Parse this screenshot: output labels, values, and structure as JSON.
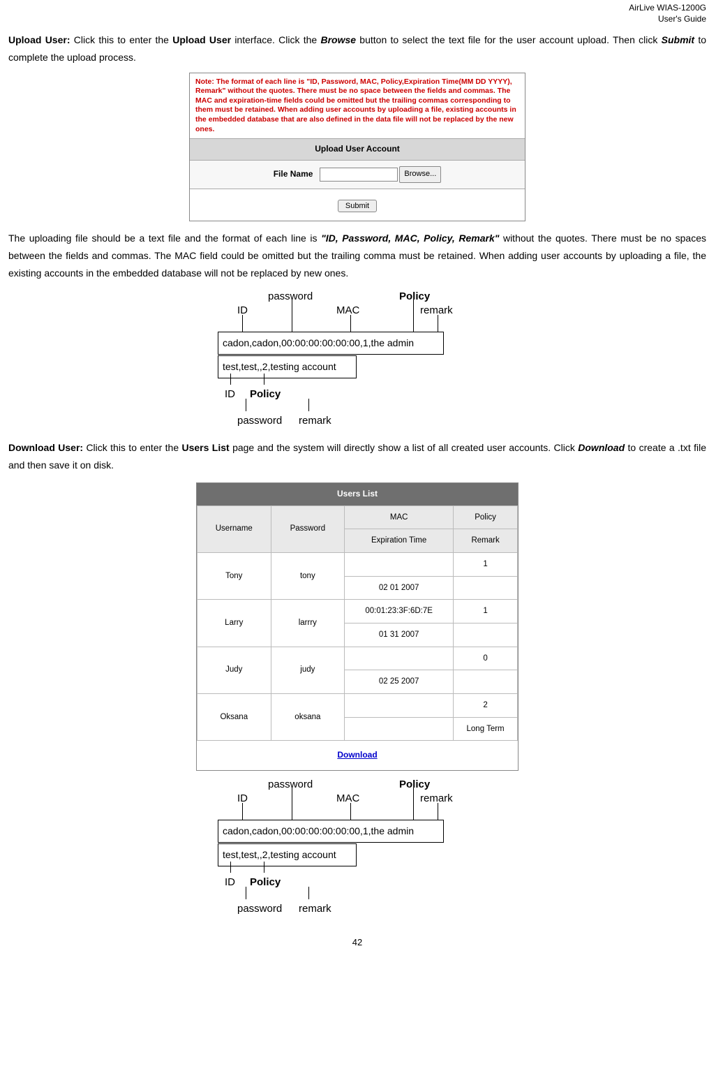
{
  "header": {
    "product": "AirLive WIAS-1200G",
    "subtitle": "User's Guide"
  },
  "p1": {
    "uploadUserLabel": "Upload User:",
    "text1": " Click this to enter the ",
    "uploadUserBold": "Upload User",
    "text2": " interface. Click the ",
    "browseBold": "Browse",
    "text3": " button to select the text file for the user account upload. Then click ",
    "submitBold": "Submit",
    "text4": " to complete the upload process."
  },
  "fig1": {
    "note": "Note: The format of each line is \"ID, Password, MAC, Policy,Expiration Time(MM DD YYYY), Remark\" without the quotes. There must be no space between the fields and commas. The MAC and expiration-time fields could be omitted but the trailing commas corresponding to them must be retained. When adding user accounts by uploading a file, existing accounts in the embedded database that are also defined in the data file will not be replaced by the new ones.",
    "barTitle": "Upload User Account",
    "fileNameLabel": "File Name",
    "browseBtn": "Browse...",
    "submitBtn": "Submit"
  },
  "p2": {
    "text1": "The uploading file should be a text file and the format of each line is ",
    "fmt": "\"ID, Password, MAC, Policy, Remark\"",
    "text2": " without the quotes. There must be no spaces between the fields and commas. The MAC field could be omitted but the trailing comma must be retained. When adding user accounts by uploading a file, the existing accounts in the embedded database will not be replaced by new ones."
  },
  "diagram": {
    "id": "ID",
    "password": "password",
    "mac": "MAC",
    "policy": "Policy",
    "remark": "remark",
    "line1": "cadon,cadon,00:00:00:00:00:00,1,the admin",
    "line2": "test,test,,2,testing account"
  },
  "p3": {
    "downloadUserLabel": "Download User:",
    "text1": " Click this to enter the ",
    "usersListBold": "Users List",
    "text2": " page and the system will directly show a list of all created user accounts. Click ",
    "downloadBold": "Download",
    "text3": " to create a .txt file and then save it on disk."
  },
  "fig3": {
    "title": "Users List",
    "headers": {
      "username": "Username",
      "password": "Password",
      "mac": "MAC",
      "policy": "Policy",
      "expiration": "Expiration Time",
      "remark": "Remark"
    },
    "rows": [
      {
        "username": "Tony",
        "password": "tony",
        "mac": "",
        "policy": "1",
        "expiration": "02 01 2007",
        "remark": ""
      },
      {
        "username": "Larry",
        "password": "larrry",
        "mac": "00:01:23:3F:6D:7E",
        "policy": "1",
        "expiration": "01 31 2007",
        "remark": ""
      },
      {
        "username": "Judy",
        "password": "judy",
        "mac": "",
        "policy": "0",
        "expiration": "02 25 2007",
        "remark": ""
      },
      {
        "username": "Oksana",
        "password": "oksana",
        "mac": "",
        "policy": "2",
        "expiration": "",
        "remark": "Long Term"
      }
    ],
    "download": "Download"
  },
  "pageNumber": "42"
}
